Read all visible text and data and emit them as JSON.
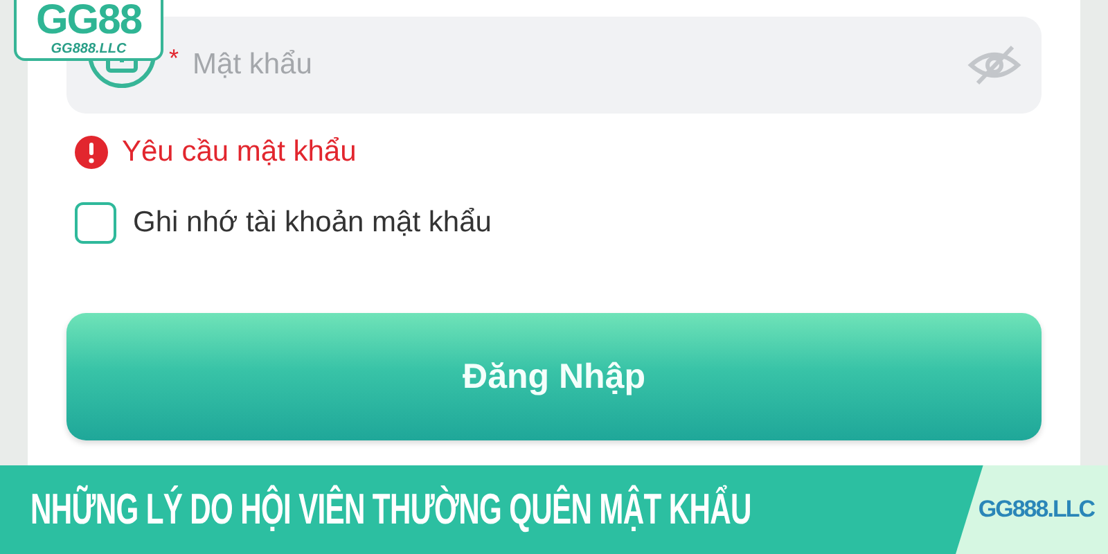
{
  "logo": {
    "title": "GG88",
    "domain": "GG888.LLC"
  },
  "password_field": {
    "required_mark": "*",
    "placeholder": "Mật khẩu",
    "masked": true
  },
  "error": "Yêu cầu mật khẩu",
  "remember": {
    "label": "Ghi nhớ tài khoản mật khẩu",
    "checked": false
  },
  "login_button": "Đăng Nhập",
  "banner": {
    "headline": "NHỮNG LÝ DO HỘI VIÊN THƯỜNG QUÊN MẬT KHẨU",
    "site": "GG888.LLC"
  }
}
